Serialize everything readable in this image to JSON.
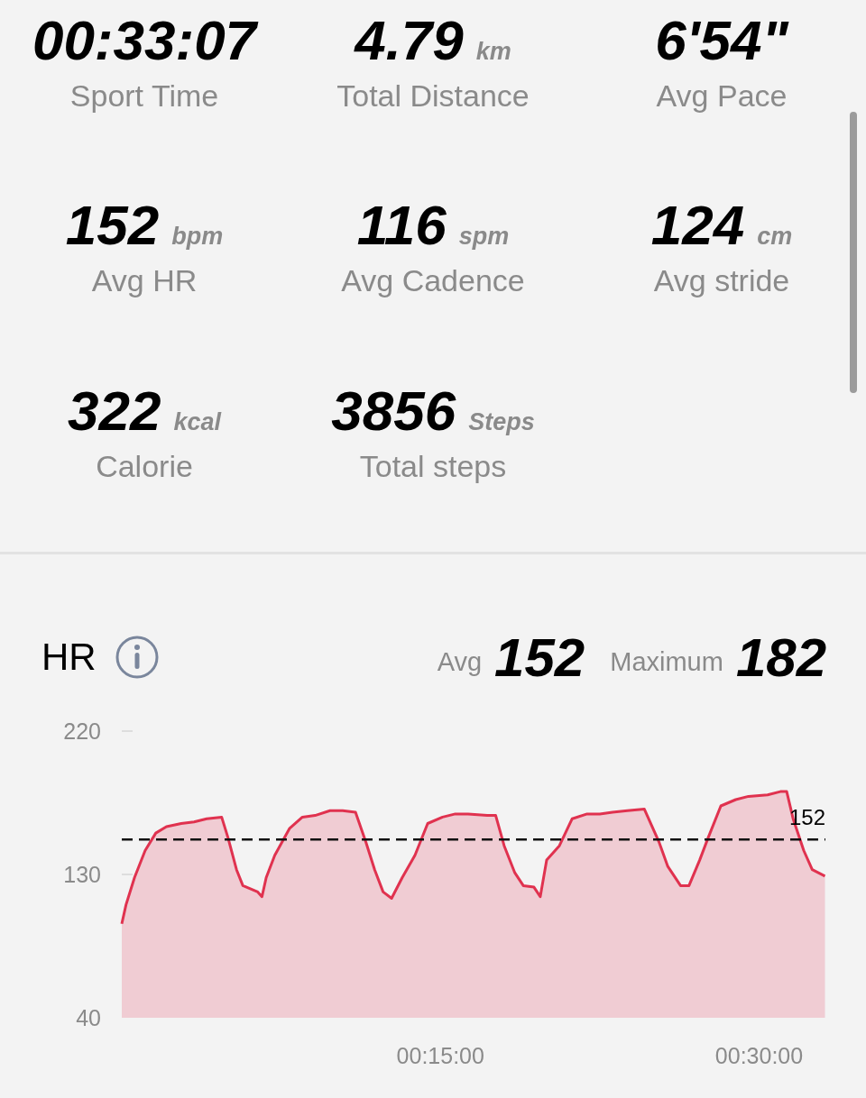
{
  "stats": [
    {
      "value": "00:33:07",
      "label": "Sport Time"
    },
    {
      "value": "4.79",
      "unit": "km",
      "label": "Total Distance"
    },
    {
      "value": "6'54\"",
      "label": "Avg Pace"
    },
    {
      "value": "152",
      "unit": "bpm",
      "label": "Avg HR"
    },
    {
      "value": "116",
      "unit": "spm",
      "label": "Avg Cadence"
    },
    {
      "value": "124",
      "unit": "cm",
      "label": "Avg stride"
    },
    {
      "value": "322",
      "unit": "kcal",
      "label": "Calorie"
    },
    {
      "value": "3856",
      "unit": "Steps",
      "label": "Total steps"
    }
  ],
  "hr": {
    "title": "HR",
    "avg_label": "Avg",
    "avg": "152",
    "max_label": "Maximum",
    "max": "182",
    "chart_data": {
      "type": "area",
      "xlim": [
        0,
        33.12
      ],
      "ylim": [
        40,
        220
      ],
      "yticks": [
        40,
        130,
        220
      ],
      "xticks": [
        {
          "value": 15,
          "label": "00:15:00"
        },
        {
          "value": 30,
          "label": "00:30:00"
        }
      ],
      "x": [
        0,
        0.2,
        0.6,
        1.1,
        1.6,
        2.1,
        2.8,
        3.4,
        4.0,
        4.7,
        5.0,
        5.4,
        5.7,
        6.4,
        6.6,
        6.8,
        7.2,
        7.9,
        8.5,
        9.1,
        9.8,
        10.4,
        11.0,
        11.5,
        11.9,
        12.3,
        12.7,
        13.2,
        13.8,
        14.4,
        15.1,
        15.7,
        16.3,
        17.2,
        17.6,
        18.0,
        18.5,
        18.9,
        19.4,
        19.7,
        20.0,
        20.6,
        21.2,
        21.9,
        22.5,
        23.1,
        23.8,
        24.6,
        25.3,
        25.7,
        26.3,
        26.7,
        27.2,
        27.6,
        28.2,
        28.9,
        29.5,
        30.4,
        31.0,
        31.3,
        31.6,
        32.1,
        32.5,
        33.1
      ],
      "series": [
        {
          "color": "#e0324f",
          "values": [
            99,
            111,
            128,
            145,
            156,
            160,
            162,
            163,
            165,
            166,
            153,
            133,
            123,
            119,
            116,
            128,
            142,
            159,
            166,
            167,
            170,
            170,
            169,
            150,
            133,
            119,
            115,
            128,
            142,
            162,
            166,
            168,
            168,
            167,
            167,
            148,
            131,
            123,
            122,
            116,
            139,
            148,
            165,
            168,
            168,
            169,
            170,
            171,
            150,
            135,
            123,
            123,
            139,
            153,
            173,
            177,
            179,
            180,
            182,
            182,
            165,
            145,
            133,
            129
          ]
        }
      ],
      "ref_lines": [
        {
          "axis": "y",
          "value": 152,
          "label": "152"
        }
      ]
    }
  }
}
